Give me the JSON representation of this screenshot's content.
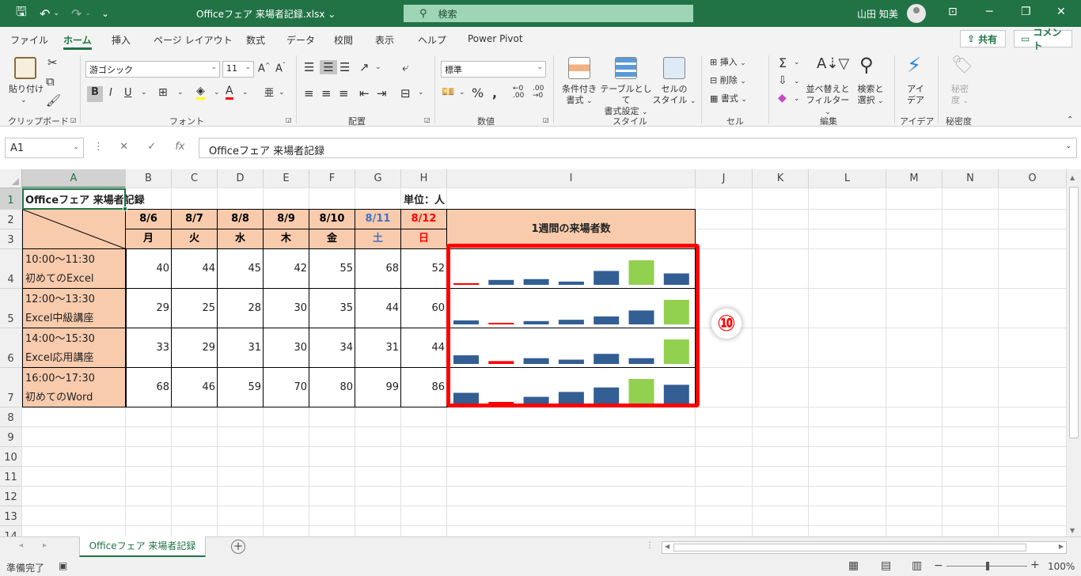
{
  "titlebar": {
    "doc_title": "Officeフェア 来場者記録.xlsx ⌄",
    "search_placeholder": "検索",
    "user_name": "山田 知美"
  },
  "menu": {
    "tabs": [
      "ファイル",
      "ホーム",
      "挿入",
      "ページ レイアウト",
      "数式",
      "データ",
      "校閲",
      "表示",
      "ヘルプ",
      "Power Pivot"
    ],
    "active": "ホーム",
    "share_label": "共有",
    "comment_label": "コメント"
  },
  "ribbon": {
    "clipboard": {
      "paste": "貼り付け",
      "label": "クリップボード"
    },
    "font": {
      "name": "游ゴシック",
      "size": "11",
      "label": "フォント"
    },
    "alignment": {
      "label": "配置"
    },
    "number": {
      "format": "標準",
      "label": "数値"
    },
    "styles": {
      "conditional": [
        "条件付き",
        "書式"
      ],
      "table": [
        "テーブルとして",
        "書式設定"
      ],
      "cell": [
        "セルの",
        "スタイル"
      ],
      "label": "スタイル"
    },
    "cells": {
      "insert": "挿入",
      "delete": "削除",
      "format": "書式",
      "label": "セル"
    },
    "editing": {
      "sort": [
        "並べ替えと",
        "フィルター"
      ],
      "find": [
        "検索と",
        "選択"
      ],
      "label": "編集"
    },
    "ideas": {
      "btn": [
        "アイ",
        "デア"
      ],
      "label": "アイデア"
    },
    "sensitivity": {
      "btn": [
        "秘密",
        "度"
      ],
      "label": "秘密度"
    }
  },
  "formula_bar": {
    "name_box": "A1",
    "content": "Officeフェア 来場者記録"
  },
  "columns": [
    "A",
    "B",
    "C",
    "D",
    "E",
    "F",
    "G",
    "H",
    "I",
    "J",
    "K",
    "L",
    "M",
    "N",
    "O"
  ],
  "rows": [
    "1",
    "2",
    "3",
    "4",
    "5",
    "6",
    "7",
    "8",
    "9",
    "10",
    "11",
    "12",
    "13",
    "14"
  ],
  "sheet": {
    "title": "Officeフェア 来場者記録",
    "unit": "単位：人",
    "dates": [
      "8/6",
      "8/7",
      "8/8",
      "8/9",
      "8/10",
      "8/11",
      "8/12"
    ],
    "weekdays": [
      "月",
      "火",
      "水",
      "木",
      "金",
      "土",
      "日"
    ],
    "chart_header": "1週間の来場者数",
    "sessions": [
      {
        "time": "10:00～11:30",
        "name": "初めてのExcel",
        "values": [
          40,
          44,
          45,
          42,
          55,
          68,
          52
        ]
      },
      {
        "time": "12:00～13:30",
        "name": "Excel中級講座",
        "values": [
          29,
          25,
          28,
          30,
          35,
          44,
          60
        ]
      },
      {
        "time": "14:00～15:30",
        "name": "Excel応用講座",
        "values": [
          33,
          29,
          31,
          30,
          34,
          31,
          44
        ]
      },
      {
        "time": "16:00～17:30",
        "name": "初めてのWord",
        "values": [
          68,
          46,
          59,
          70,
          80,
          99,
          86
        ]
      }
    ],
    "callout": "⑩"
  },
  "colors": {
    "header_bg": "#f8cbad",
    "saturday": "#4472c4",
    "sunday": "#ff0000",
    "bar_normal": "#335e93",
    "bar_max": "#92d050",
    "bar_min": "#ff0000",
    "excel_green": "#217346"
  },
  "chart_data": {
    "type": "bar",
    "categories": [
      "8/6",
      "8/7",
      "8/8",
      "8/9",
      "8/10",
      "8/11",
      "8/12"
    ],
    "series": [
      {
        "values": [
          40,
          44,
          45,
          42,
          55,
          68,
          52
        ]
      },
      {
        "values": [
          29,
          25,
          28,
          30,
          35,
          44,
          60
        ]
      },
      {
        "values": [
          33,
          29,
          31,
          30,
          34,
          31,
          44
        ]
      },
      {
        "values": [
          68,
          46,
          59,
          70,
          80,
          99,
          86
        ]
      }
    ]
  },
  "sheet_tabs": [
    "Officeフェア 来場者記録"
  ],
  "status": {
    "ready": "準備完了",
    "zoom": "100%"
  }
}
